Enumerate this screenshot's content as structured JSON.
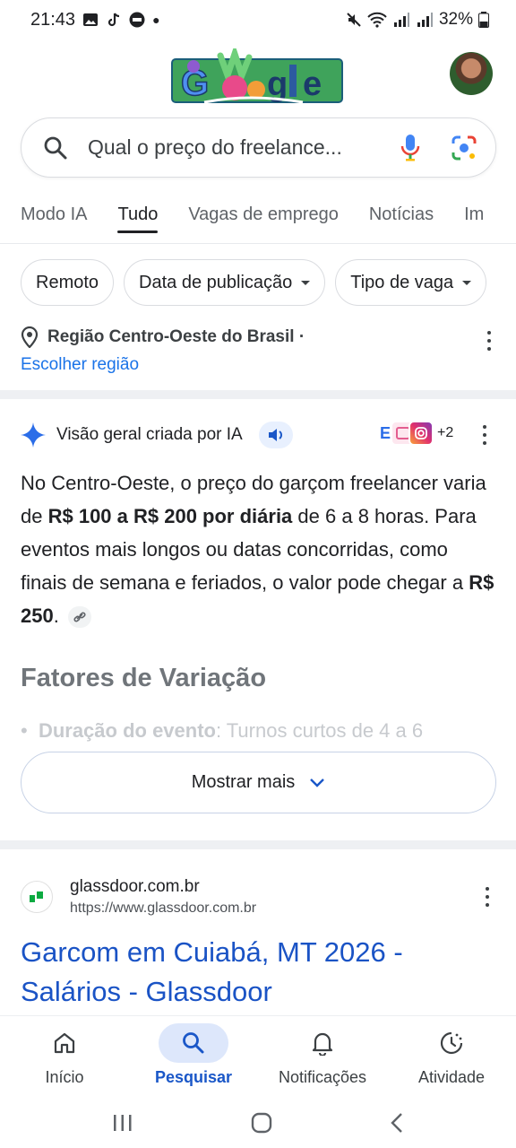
{
  "status_bar": {
    "time": "21:43",
    "battery": "32%"
  },
  "search": {
    "query": "Qual o preço do freelance..."
  },
  "tabs": [
    {
      "label": "Modo IA"
    },
    {
      "label": "Tudo"
    },
    {
      "label": "Vagas de emprego"
    },
    {
      "label": "Notícias"
    },
    {
      "label": "Im"
    }
  ],
  "chips": [
    {
      "label": "Remoto"
    },
    {
      "label": "Data de publicação"
    },
    {
      "label": "Tipo de vaga"
    }
  ],
  "region": {
    "name": "Região Centro-Oeste do Brasil ·",
    "link": "Escolher região"
  },
  "ai_overview": {
    "title": "Visão geral criada por IA",
    "sources_more": "+2",
    "text_1": "No Centro-Oeste, o preço do garçom freelancer varia de ",
    "bold_1": "R$ 100 a R$ 200 por diária",
    "text_2": " de 6 a 8 horas. Para eventos mais longos ou datas concorridas, como finais de semana e feriados, o valor pode chegar a ",
    "bold_2": "R$ 250",
    "text_3": ".",
    "section_title": "Fatores de Variação",
    "bullet_bold": "Duração do evento",
    "bullet_text": ": Turnos curtos de 4 a 6",
    "show_more": "Mostrar mais"
  },
  "result": {
    "site_name": "glassdoor.com.br",
    "url": "https://www.glassdoor.com.br",
    "title": "Garcom em Cuiabá, MT 2026 - Salários - Glassdoor"
  },
  "bottom_nav": [
    {
      "label": "Início",
      "icon": "home-icon"
    },
    {
      "label": "Pesquisar",
      "icon": "search-icon"
    },
    {
      "label": "Notificações",
      "icon": "bell-icon"
    },
    {
      "label": "Atividade",
      "icon": "activity-icon"
    }
  ],
  "colors": {
    "link": "#1a73e8",
    "title_link": "#1a53c5",
    "active_nav": "#1a57c8",
    "chip_border": "#dadce0"
  }
}
